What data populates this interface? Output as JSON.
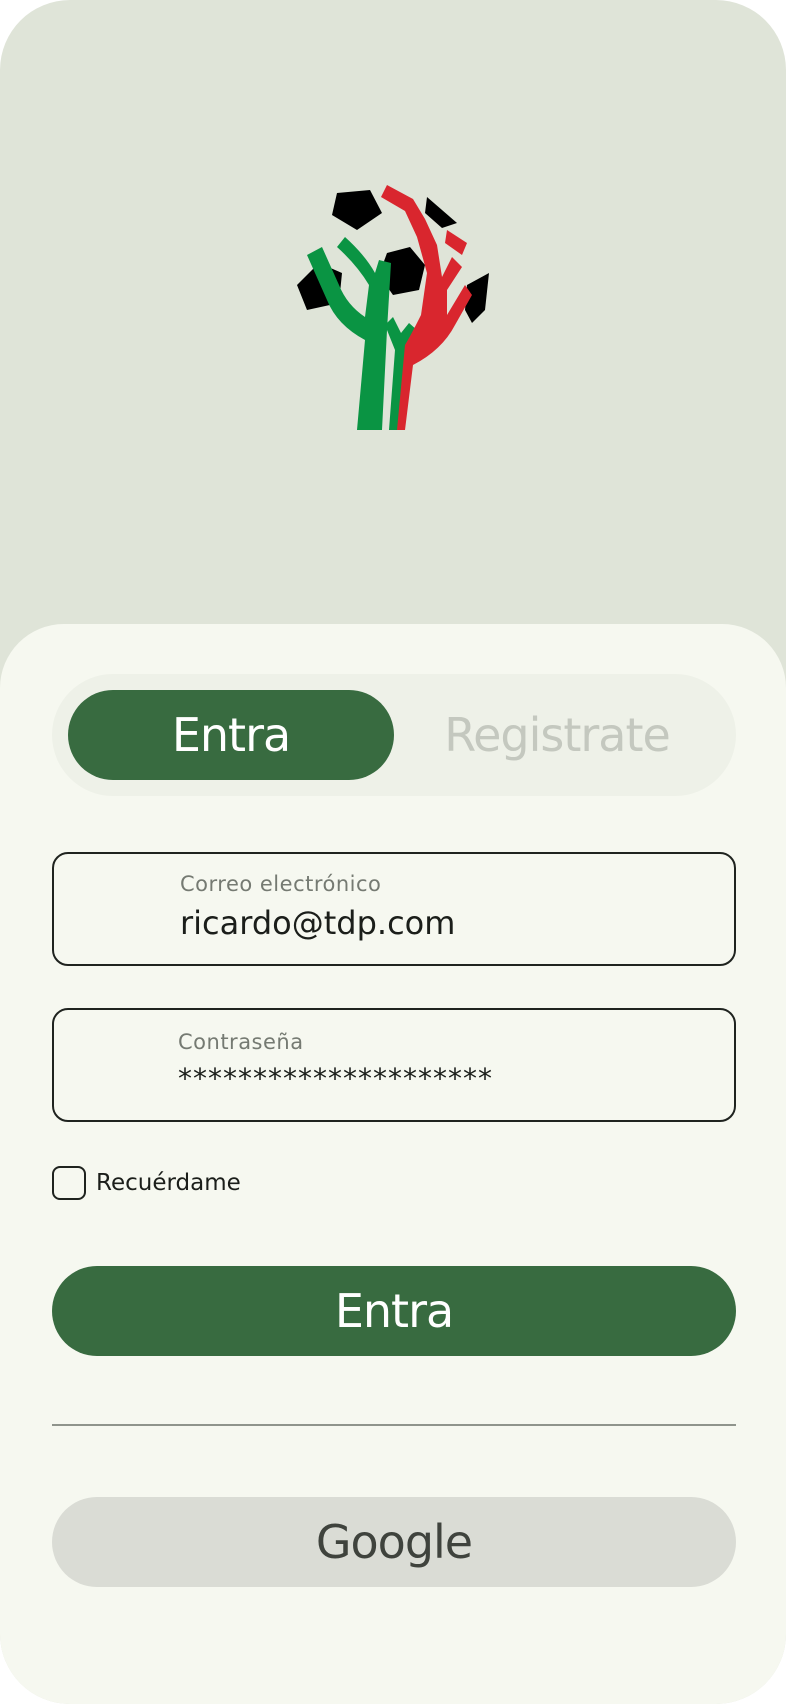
{
  "tabs": [
    {
      "label": "Entra",
      "active": true
    },
    {
      "label": "Registrate",
      "active": false
    }
  ],
  "email": {
    "label": "Correo electrónico",
    "value": "ricardo@tdp.com"
  },
  "password": {
    "label": "Contraseña",
    "value": "*********************"
  },
  "remember": {
    "label": "Recuérdame",
    "checked": false
  },
  "submit_label": "Entra",
  "google_label": "Google",
  "colors": {
    "primary": "#386b40",
    "hero_background": "#dfe4d8",
    "sheet_background": "#f6f8f0",
    "logo_green": "#0a9443",
    "logo_red": "#d9262e",
    "logo_black": "#000000"
  },
  "icons": {
    "logo": "soccer-ball-tree-logo"
  }
}
